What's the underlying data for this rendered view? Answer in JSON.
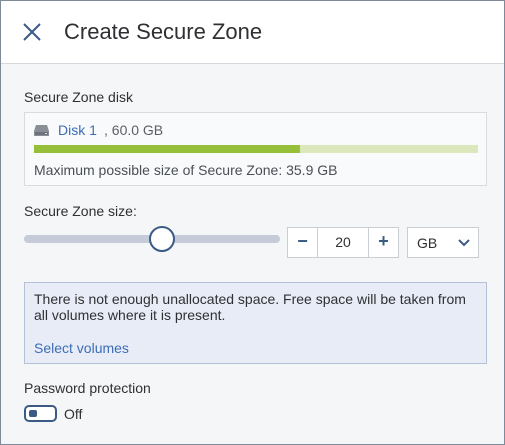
{
  "dialog": {
    "title": "Create Secure Zone",
    "close_icon": "close-icon"
  },
  "disk_section": {
    "label": "Secure Zone disk",
    "disk_icon": "hard-disk-icon",
    "disk_name": "Disk 1",
    "disk_size": ", 60.0 GB",
    "usage_fraction": 0.6,
    "max_size_text": "Maximum possible size of Secure Zone: 35.9 GB",
    "colors": {
      "fill": "#97c03a",
      "track": "#dce7bc"
    }
  },
  "size_section": {
    "label": "Secure Zone size:",
    "slider_fraction": 0.54,
    "stepper": {
      "minus_label": "−",
      "value": "20",
      "plus_label": "+"
    },
    "unit": {
      "selected": "GB",
      "chevron_icon": "chevron-down-icon"
    }
  },
  "info": {
    "message": "There is not enough unallocated space. Free space will be taken from all volumes where it is present.",
    "link_label": "Select volumes"
  },
  "password": {
    "label": "Password protection",
    "toggle_state": "Off",
    "enabled": false
  },
  "colors": {
    "accent": "#3b5b86",
    "link": "#3d6db5",
    "info_background": "#e7ecf6"
  }
}
